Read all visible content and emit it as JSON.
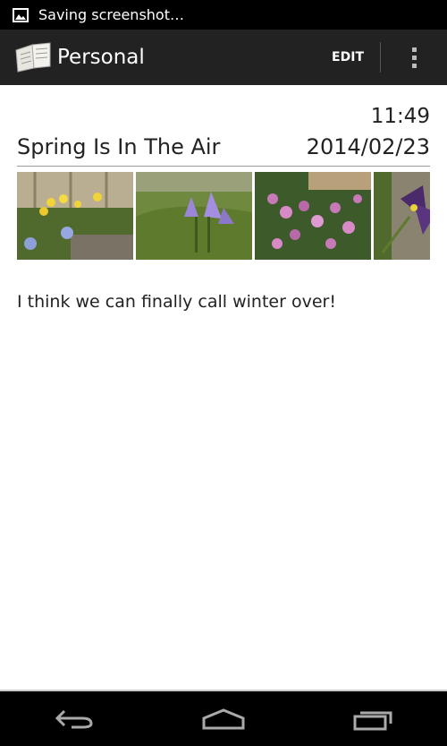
{
  "status_bar": {
    "notification_icon": "image-icon",
    "text": "Saving screenshot…"
  },
  "action_bar": {
    "app_icon": "notebook-icon",
    "title": "Personal",
    "edit_label": "EDIT",
    "overflow_icon": "overflow-menu-icon"
  },
  "entry": {
    "time": "11:49",
    "title": "Spring Is In The Air",
    "date": "2014/02/23",
    "photos": [
      {
        "subject": "daffodils and crocus"
      },
      {
        "subject": "purple crocus in grass"
      },
      {
        "subject": "pink heather"
      },
      {
        "subject": "purple iris"
      }
    ],
    "body": "I think we can finally call winter over!"
  },
  "nav_bar": {
    "back_icon": "back-icon",
    "home_icon": "home-icon",
    "recents_icon": "recents-icon"
  }
}
